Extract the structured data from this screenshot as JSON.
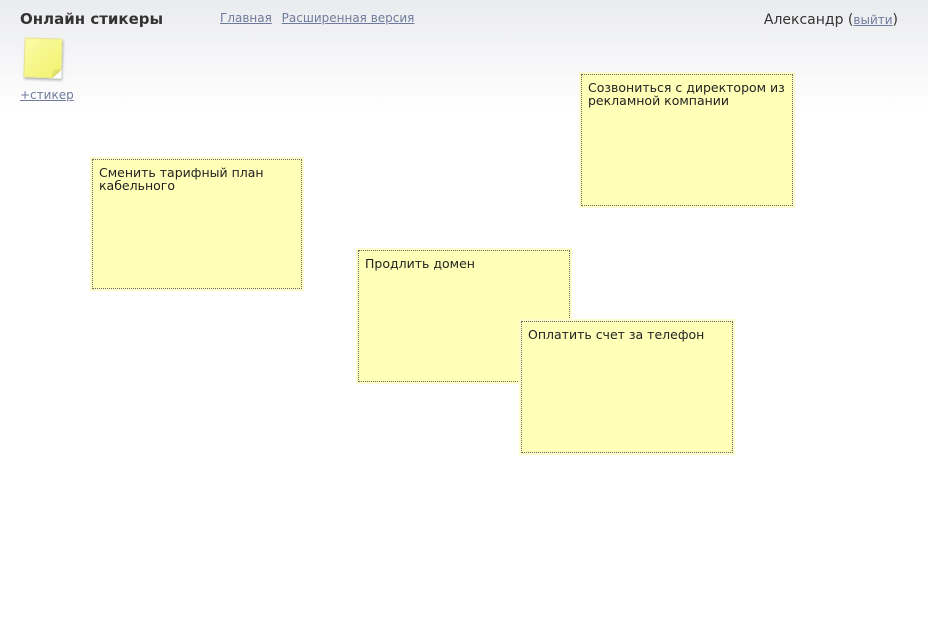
{
  "header": {
    "app_title": "Онлайн стикеры",
    "nav": {
      "home": "Главная",
      "extended": "Расширенная версия"
    },
    "user": {
      "name": "Александр",
      "open_paren": " (",
      "logout": "выйти",
      "close_paren": ")"
    }
  },
  "toolbar": {
    "add_sticker_label": "+стикер",
    "add_sticker_icon": "sticky-note-icon"
  },
  "stickers": [
    {
      "text": "Сменить тарифный план кабельного"
    },
    {
      "text": "Созвониться с директором из рекламной компании"
    },
    {
      "text": "Продлить домен"
    },
    {
      "text": "Оплатить счет за телефон"
    }
  ],
  "colors": {
    "sticker_bg": "#ffffb8",
    "link": "#6f7b9c"
  }
}
